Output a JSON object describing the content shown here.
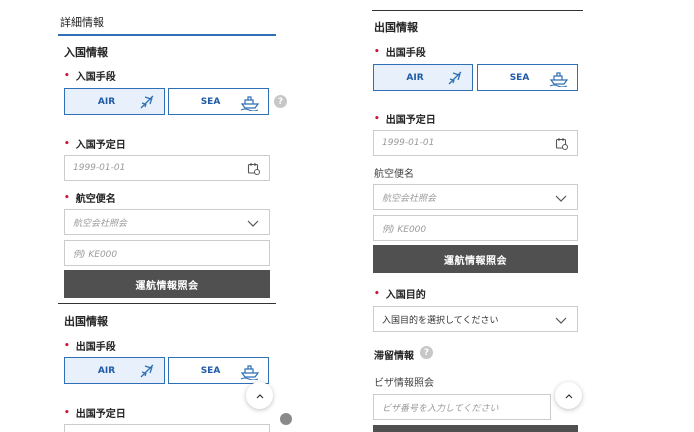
{
  "left": {
    "header_title": "詳細情報",
    "entry_title": "入国情報",
    "entry_means_label": "入国手段",
    "air_label": "AIR",
    "sea_label": "SEA",
    "help_mark": "?",
    "entry_date_label": "入国予定日",
    "entry_date_placeholder": "1999-01-01",
    "flight_label": "航空便名",
    "airline_placeholder": "航空会社照会",
    "flight_no_placeholder": "例) KE000",
    "flight_lookup_button": "運航情報照会",
    "exit_title": "出国情報",
    "exit_means_label": "出国手段",
    "exit_air_label": "AIR",
    "exit_sea_label": "SEA",
    "exit_date_label": "出国予定日"
  },
  "right": {
    "exit_title": "出国情報",
    "exit_means_label": "出国手段",
    "air_label": "AIR",
    "sea_label": "SEA",
    "exit_date_label": "出国予定日",
    "exit_date_placeholder": "1999-01-01",
    "flight_label": "航空便名",
    "airline_placeholder": "航空会社照会",
    "flight_no_placeholder": "例) KE000",
    "flight_lookup_button": "運航情報照会",
    "purpose_label": "入国目的",
    "purpose_value": "入国目的を選択してください",
    "stay_title": "滞留情報",
    "help_mark": "?",
    "visa_label": "ビザ情報照会",
    "visa_placeholder": "ビザ番号を入力してください"
  },
  "colors": {
    "accent_blue": "#2f6fb5",
    "selected_bg": "#e8f1fb",
    "required_red": "#d0103a",
    "dark_button": "#505050"
  }
}
